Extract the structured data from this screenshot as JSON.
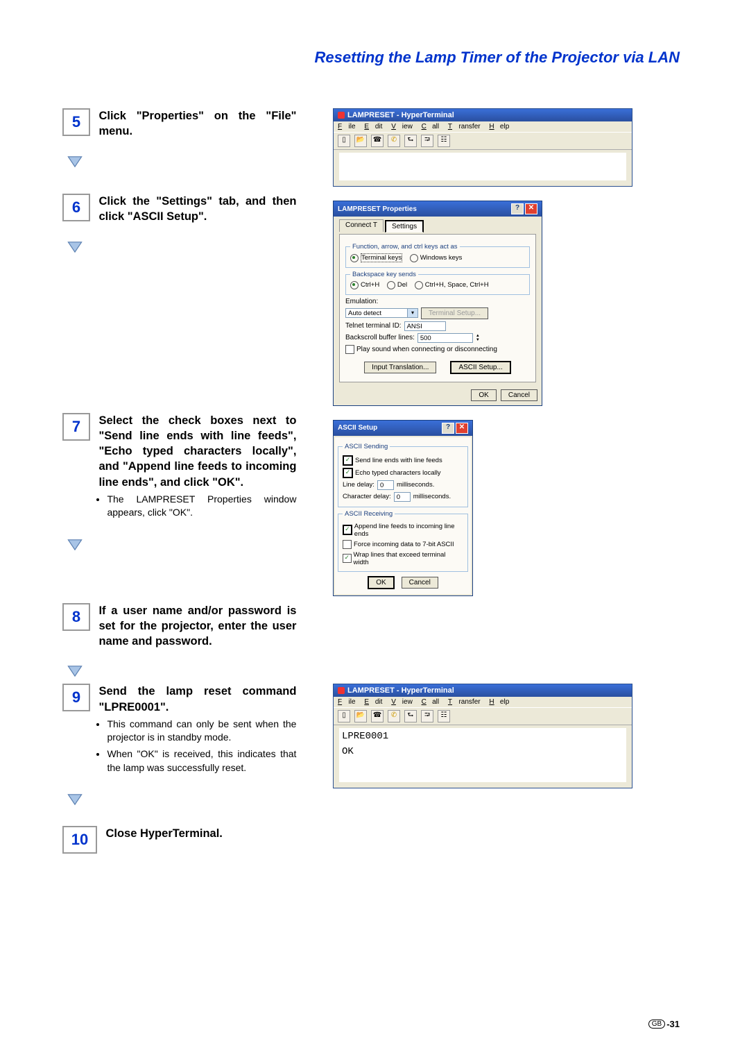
{
  "title": "Resetting the Lamp Timer of the Projector via LAN",
  "steps": {
    "s5": {
      "num": "5",
      "text": "Click \"Properties\" on the \"File\" menu."
    },
    "s6": {
      "num": "6",
      "text": "Click the \"Settings\" tab, and then click \"ASCII Setup\"."
    },
    "s7": {
      "num": "7",
      "text": "Select the check boxes next to \"Send line ends with line feeds\", \"Echo typed characters locally\", and \"Append line feeds to incoming line ends\", and click \"OK\".",
      "note": "The LAMPRESET Properties window appears, click \"OK\"."
    },
    "s8": {
      "num": "8",
      "text": "If a user name and/or password is set for the projector, enter the user name and password."
    },
    "s9": {
      "num": "9",
      "text": "Send the lamp reset command \"LPRE0001\".",
      "notes": [
        "This command can only be sent when the projector is in standby mode.",
        "When \"OK\" is received, this indicates that the lamp was successfully reset."
      ]
    },
    "s10": {
      "num": "10",
      "text": "Close HyperTerminal."
    }
  },
  "ht": {
    "title": "LAMPRESET - HyperTerminal",
    "menu": [
      "File",
      "Edit",
      "View",
      "Call",
      "Transfer",
      "Help"
    ]
  },
  "propsDlg": {
    "title": "LAMPRESET Properties",
    "tabs": [
      "Connect T",
      "Settings"
    ],
    "group1": {
      "legend": "Function, arrow, and ctrl keys act as",
      "opt1": "Terminal keys",
      "opt2": "Windows keys"
    },
    "group2": {
      "legend": "Backspace key sends",
      "o1": "Ctrl+H",
      "o2": "Del",
      "o3": "Ctrl+H, Space, Ctrl+H"
    },
    "emu": {
      "label": "Emulation:",
      "value": "Auto detect",
      "btn": "Terminal Setup..."
    },
    "telnet": {
      "label": "Telnet terminal ID:",
      "value": "ANSI"
    },
    "back": {
      "label": "Backscroll buffer lines:",
      "value": "500"
    },
    "sound": "Play sound when connecting or disconnecting",
    "btns": {
      "input": "Input Translation...",
      "ascii": "ASCII Setup...",
      "ok": "OK",
      "cancel": "Cancel"
    }
  },
  "asciiDlg": {
    "title": "ASCII Setup",
    "g1": {
      "legend": "ASCII Sending",
      "c1": "Send line ends with line feeds",
      "c2": "Echo typed characters locally",
      "line": "Line delay:",
      "line_v": "0",
      "line_u": "milliseconds.",
      "char": "Character delay:",
      "char_v": "0",
      "char_u": "milliseconds."
    },
    "g2": {
      "legend": "ASCII Receiving",
      "c1": "Append line feeds to incoming line ends",
      "c2": "Force incoming data to 7-bit ASCII",
      "c3": "Wrap lines that exceed terminal width"
    },
    "ok": "OK",
    "cancel": "Cancel"
  },
  "term": {
    "cmd": "LPRE0001",
    "resp": "OK"
  },
  "footer": {
    "region": "GB",
    "page": "-31"
  }
}
